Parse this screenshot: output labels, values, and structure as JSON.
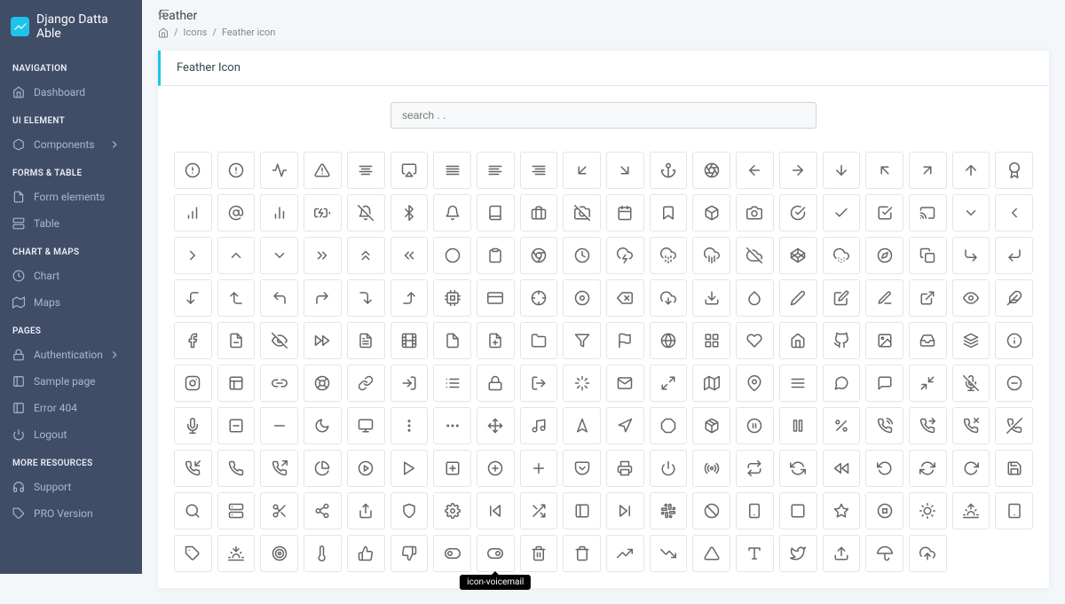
{
  "brand": "Django Datta Able",
  "page": {
    "title": "feather",
    "card_title": "Feather Icon"
  },
  "crumbs": {
    "icons": "Icons",
    "current": "Feather icon"
  },
  "search": {
    "placeholder": "search . ."
  },
  "tooltip": {
    "text": "icon-voicemail"
  },
  "nav": {
    "sec_navigation": "NAVIGATION",
    "sec_ui": "UI ELEMENT",
    "sec_forms": "FORMS & TABLE",
    "sec_chart": "CHART & MAPS",
    "sec_pages": "PAGES",
    "sec_more": "MORE RESOURCES",
    "dashboard": "Dashboard",
    "components": "Components",
    "form_elements": "Form elements",
    "table": "Table",
    "chart": "Chart",
    "maps": "Maps",
    "auth": "Authentication",
    "sample": "Sample page",
    "e404": "Error 404",
    "logout": "Logout",
    "support": "Support",
    "pro": "PRO Version"
  },
  "icons": [
    "alert-circle",
    "alert-circle",
    "activity",
    "alert-triangle",
    "align-center",
    "airplay",
    "align-justify",
    "align-left",
    "align-right",
    "arrow-down-left",
    "arrow-down-right",
    "anchor",
    "aperture",
    "arrow-left",
    "arrow-right",
    "arrow-down",
    "arrow-up-left",
    "arrow-up-right",
    "arrow-up",
    "award",
    "bar-chart",
    "at-sign",
    "bar-chart-2",
    "battery-charging",
    "bell-off",
    "bluetooth",
    "bell",
    "book",
    "briefcase",
    "camera-off",
    "calendar",
    "bookmark",
    "box",
    "camera",
    "check-circle",
    "check",
    "check-square",
    "cast",
    "chevron-down",
    "chevron-left",
    "chevron-right",
    "chevron-up",
    "chevron-down",
    "chevrons-right",
    "chevrons-up",
    "chevrons-left",
    "circle",
    "clipboard",
    "chrome",
    "clock",
    "cloud-lightning",
    "cloud-drizzle",
    "cloud-rain",
    "cloud-off",
    "codepen",
    "cloud-snow",
    "compass",
    "copy",
    "corner-down-right",
    "corner-down-left",
    "corner-left-down",
    "corner-left-up",
    "corner-up-left",
    "corner-up-right",
    "corner-right-down",
    "corner-right-up",
    "cpu",
    "credit-card",
    "crosshair",
    "disc",
    "delete",
    "download-cloud",
    "download",
    "droplet",
    "edit-2",
    "edit",
    "edit-3",
    "external-link",
    "eye",
    "feather",
    "facebook",
    "file-minus",
    "eye-off",
    "fast-forward",
    "file-text",
    "film",
    "file",
    "file-plus",
    "folder",
    "filter",
    "flag",
    "globe",
    "grid",
    "heart",
    "home",
    "github",
    "image",
    "inbox",
    "layers",
    "info",
    "instagram",
    "layout",
    "link-2",
    "life-buoy",
    "link",
    "log-in",
    "list",
    "lock",
    "log-out",
    "loader",
    "mail",
    "maximize-2",
    "map",
    "map-pin",
    "menu",
    "message-circle",
    "message-square",
    "minimize-2",
    "mic-off",
    "minus-circle",
    "mic",
    "minus-square",
    "minus",
    "moon",
    "monitor",
    "more-vertical",
    "more-horizontal",
    "move",
    "music",
    "navigation-2",
    "navigation",
    "octagon",
    "package",
    "pause-circle",
    "pause",
    "percent",
    "phone-call",
    "phone-forwarded",
    "phone-missed",
    "phone-off",
    "phone-incoming",
    "phone",
    "phone-outgoing",
    "pie-chart",
    "play-circle",
    "play",
    "plus-square",
    "plus-circle",
    "plus",
    "pocket",
    "printer",
    "power",
    "radio",
    "repeat",
    "refresh-ccw",
    "rewind",
    "rotate-ccw",
    "refresh-cw",
    "rotate-cw",
    "save",
    "search",
    "server",
    "scissors",
    "share-2",
    "share",
    "shield",
    "settings",
    "skip-back",
    "shuffle",
    "sidebar",
    "skip-forward",
    "slack",
    "slash",
    "smartphone",
    "square",
    "star",
    "stop-circle",
    "sun",
    "sunrise",
    "tablet",
    "tag",
    "sunset",
    "target",
    "thermometer",
    "thumbs-up",
    "thumbs-down",
    "toggle-left",
    "toggle-right",
    "trash-2",
    "trash",
    "trending-up",
    "trending-down",
    "triangle",
    "type",
    "twitter",
    "upload",
    "umbrella",
    "upload-cloud"
  ]
}
